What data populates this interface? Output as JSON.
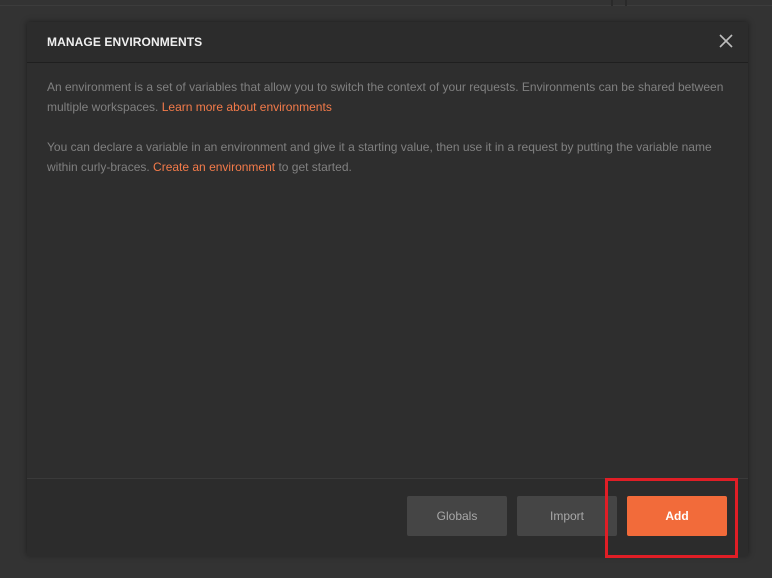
{
  "modal": {
    "title": "MANAGE ENVIRONMENTS",
    "close_icon": "close-icon",
    "paragraph1": {
      "text": "An environment is a set of variables that allow you to switch the context of your requests. Environments can be shared between multiple workspaces. ",
      "link": "Learn more about environments"
    },
    "paragraph2": {
      "text_before": "You can declare a variable in an environment and give it a starting value, then use it in a request by putting the variable name within curly-braces. ",
      "link": "Create an environment",
      "text_after": " to get started."
    }
  },
  "footer": {
    "globals_label": "Globals",
    "import_label": "Import",
    "add_label": "Add"
  },
  "colors": {
    "accent": "#f26b3a",
    "link": "#f47b4a",
    "highlight": "#e01e26",
    "modal_bg": "#2b2b2b",
    "secondary_button": "#454545"
  }
}
